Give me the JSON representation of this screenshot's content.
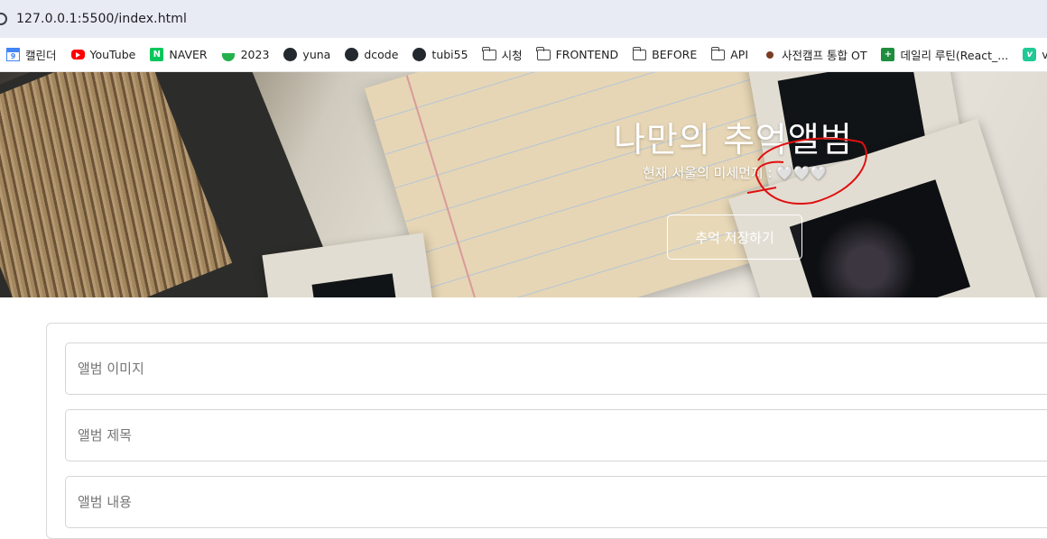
{
  "browser": {
    "url": "127.0.0.1:5500/index.html"
  },
  "bookmarks": [
    {
      "label": "캘린더",
      "icon": "google-calendar-icon"
    },
    {
      "label": "YouTube",
      "icon": "youtube-icon"
    },
    {
      "label": "NAVER",
      "icon": "naver-icon"
    },
    {
      "label": "2023",
      "icon": "leaf-icon"
    },
    {
      "label": "yuna",
      "icon": "github-icon"
    },
    {
      "label": "dcode",
      "icon": "github-icon"
    },
    {
      "label": "tubi55",
      "icon": "github-icon"
    },
    {
      "label": "시청",
      "icon": "folder-icon"
    },
    {
      "label": "FRONTEND",
      "icon": "folder-icon"
    },
    {
      "label": "BEFORE",
      "icon": "folder-icon"
    },
    {
      "label": "API",
      "icon": "folder-icon"
    },
    {
      "label": "사전캠프 통합 OT",
      "icon": "person-icon"
    },
    {
      "label": "데일리 루틴(React_...",
      "icon": "sheets-plus-icon"
    },
    {
      "label": "velog",
      "icon": "velog-icon"
    }
  ],
  "hero": {
    "title": "나만의 추억앨범",
    "dust_label": "현재 서울의 미세먼지 : ",
    "dust_value": "🤍🤍🤍",
    "save_button": "추억 저장하기"
  },
  "form": {
    "image_placeholder": "앨범 이미지",
    "title_placeholder": "앨범 제목",
    "content_placeholder": "앨범 내용"
  },
  "colors": {
    "annotation": "#e01010",
    "urlbar": "#e8eaf4"
  }
}
